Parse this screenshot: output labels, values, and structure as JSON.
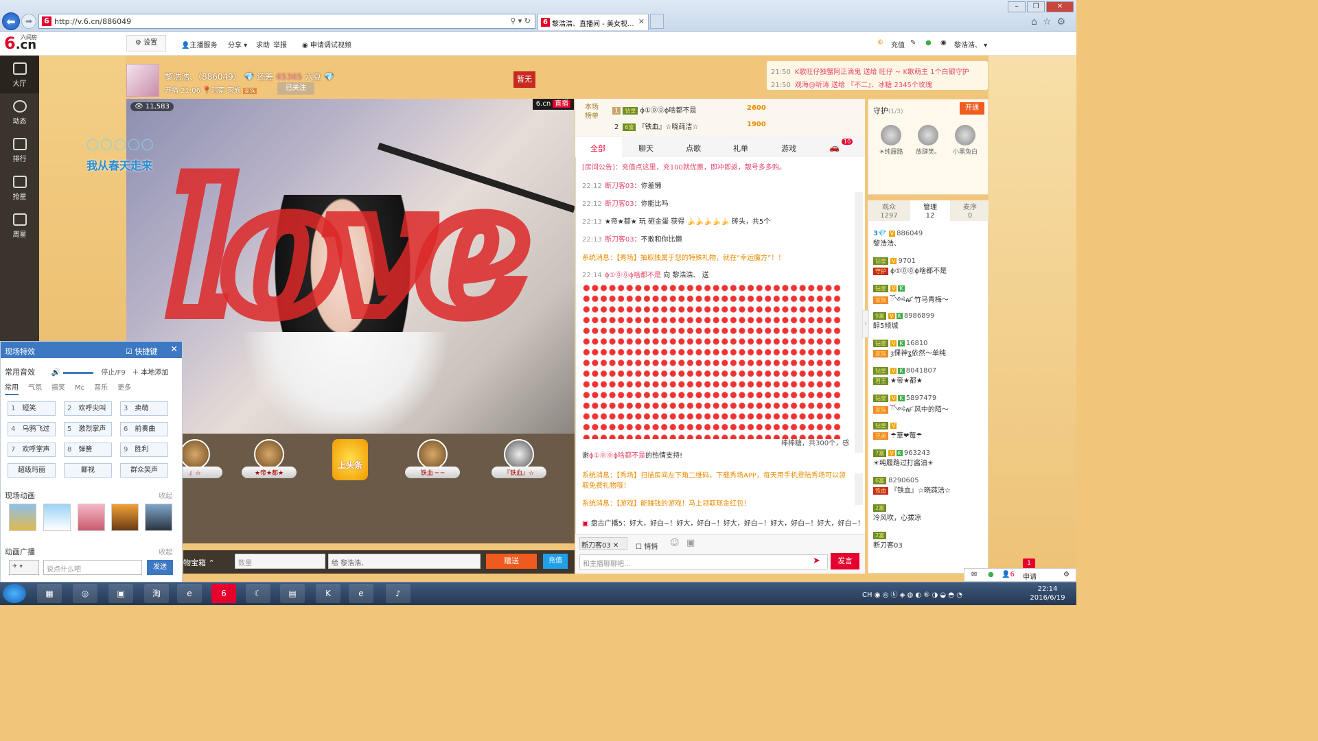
{
  "browser": {
    "url": "http://v.6.cn/886049",
    "tab_title": "黎浩浩、直播间 - 美女视...",
    "back": "⬅",
    "fwd": "➡",
    "addr_tools": "⚲ ▾ ↻"
  },
  "header": {
    "logo": "6.cn",
    "logo_small": "六间房",
    "settings": "⚙ 设置",
    "anchor_service": "主播服务",
    "share": "分享",
    "help": "求助",
    "report": "举报",
    "debug": "申请调试视频",
    "charge": "充值",
    "user": "黎浩浩、"
  },
  "sidebar": {
    "items": [
      {
        "label": "大厅",
        "icon": "tv-icon"
      },
      {
        "label": "动态",
        "icon": "compass-icon"
      },
      {
        "label": "排行",
        "icon": "crown-icon"
      },
      {
        "label": "抢星",
        "icon": "star-icon"
      },
      {
        "label": "周星",
        "icon": "gift-icon"
      }
    ]
  },
  "room": {
    "title": "黎浩浩、（886049）",
    "gap_prefix": "还差",
    "gap_value": "65365",
    "gap_unit": "六豆",
    "start": "开播 21:06",
    "location": "河南",
    "family": "家族",
    "follow": "已关注",
    "pause": "暂无",
    "viewers": "11,583",
    "live_logo": "6.cn",
    "live": "直播"
  },
  "notices": [
    {
      "time": "21:50",
      "text": "K歌旺仔独蟹阿正滴鬼 送给 旺仔 ~ K歌萌主 1个白银守护"
    },
    {
      "time": "21:50",
      "text": "观海@听涛 送给 『不二』、冰糖 2345个玫瑰"
    }
  ],
  "overlay": {
    "love": "love",
    "spring": "我从春天走来",
    "bubbles": "◯◯◯◯◯"
  },
  "rank_strip": [
    {
      "name": "』☆"
    },
    {
      "name": "★帝★都★"
    },
    {
      "name": "上头条"
    },
    {
      "name": "铁血 ─ ─"
    },
    {
      "name": "『铁血』☆"
    }
  ],
  "fx": {
    "title": "现场特效",
    "shortcut": "快捷键",
    "close": "✕",
    "sound_label": "常用音效",
    "stop": "停止/F9",
    "add_local": "＋ 本地添加",
    "tabs": [
      "常用",
      "气氛",
      "搞笑",
      "Mc",
      "音乐",
      "更多"
    ],
    "buttons": [
      {
        "n": "1",
        "l": "短笑"
      },
      {
        "n": "2",
        "l": "欢呼尖叫"
      },
      {
        "n": "3",
        "l": "卖萌"
      },
      {
        "n": "4",
        "l": "乌鸦飞过"
      },
      {
        "n": "5",
        "l": "激烈掌声"
      },
      {
        "n": "6",
        "l": "前奏曲"
      },
      {
        "n": "7",
        "l": "欢呼掌声"
      },
      {
        "n": "8",
        "l": "弹簧"
      },
      {
        "n": "9",
        "l": "胜利"
      }
    ],
    "wide_buttons": [
      "超级玛丽",
      "鄙视",
      "群众笑声"
    ],
    "anim_label": "现场动画",
    "collapse": "收起",
    "bc_label": "动画广播",
    "collapse2": "收起",
    "input_placeholder": "说点什么吧",
    "send": "发送"
  },
  "giftbar": {
    "treasure": "物宝箱 ⌃",
    "qty_placeholder": "数量",
    "to_prefix": "给",
    "to_name": "黎浩浩、",
    "give": "赠送",
    "charge": "充值"
  },
  "chat": {
    "rank_label": "本场榜单",
    "ranks": [
      {
        "pos": "1",
        "name": "ϕ①⓪⓪ϕ啥都不是",
        "amt": "2600"
      },
      {
        "pos": "2",
        "name": "『铁血』☆晓莼洁☆",
        "amt": "1900"
      }
    ],
    "tabs": [
      "全部",
      "聊天",
      "点歌",
      "礼单",
      "游戏"
    ],
    "tab_badge": "10",
    "announce_label": "[房间公告]",
    "announce": "：充值点这里，充100就优惠，即冲即返，靓号多多购。",
    "lines": [
      {
        "tm": "22:12",
        "nm": "断刀客03",
        "msg": "：你差懒"
      },
      {
        "tm": "22:12",
        "nm": "断刀客03",
        "msg": "：你能比吗"
      },
      {
        "tm": "22:13",
        "nm": "★帝★都★",
        "msg": "玩 砸金蛋 获得 🍌🍌🍌🍌🍌 砖头，共5个"
      },
      {
        "tm": "22:13",
        "nm": "断刀客03",
        "msg": "：不敢和你比懒"
      }
    ],
    "sys1": "系统消息：【秀场】抽取独属于您的特殊礼物，就在“幸运魔方”！！",
    "gift_line_tm": "22:14",
    "gift_line_nm": "ϕ①⓪⓪ϕ啥都不是",
    "gift_line_to": "向 黎浩浩、 送",
    "candy_tail": "棒棒糖，共300个，感",
    "thanks_pre": "谢",
    "thanks_nm": "ϕ①⓪⓪ϕ啥都不是",
    "thanks_post": "的热情支持!",
    "sys2": "系统消息：【秀场】扫描房间左下角二维码，下载秀场APP，每天用手机登陆秀场可以领",
    "sys2b": "取免费礼物哦！",
    "sys3": "系统消息：【游戏】能赚钱的游戏！马上领取现金红包！",
    "broadcast": "盘古广播5：好大，好白~！好大，好白~！好大，好白~！好大，好白~！好大，好白~！好",
    "to_user": "断刀客03",
    "whisper": "悄悄",
    "input_placeholder": "和主播聊聊吧...",
    "send": "发言"
  },
  "guard": {
    "title": "守护",
    "count": "(1/3)",
    "open": "开通",
    "members": [
      "☀纯履路",
      "放肆笑。",
      "小黑兔白"
    ]
  },
  "users": {
    "tabs": [
      {
        "l": "观众",
        "n": "1297"
      },
      {
        "l": "管理",
        "n": "12"
      },
      {
        "l": "麦序",
        "n": "0"
      }
    ],
    "list": [
      {
        "num": "886049",
        "name": "黎浩浩、"
      },
      {
        "num": "9701",
        "name": "ϕ①⓪⓪ϕ啥都不是"
      },
      {
        "num": "",
        "name": "ོ༺ꫛ 竹马青梅～"
      },
      {
        "num": "8986899",
        "name": "醉5倾城"
      },
      {
        "num": "16810",
        "name": "ȝ倮神ʓ依然～单纯"
      },
      {
        "num": "8041807",
        "name": "★帝★都★"
      },
      {
        "num": "5897479",
        "name": "ོ༺ꫛ 风中的陌～"
      },
      {
        "num": "",
        "name": "☂華❤莓☂"
      },
      {
        "num": "963243",
        "name": "☀纯履路过打酱油☀"
      },
      {
        "num": "8290605",
        "name": "『铁血』☆晓莼洁☆"
      },
      {
        "num": "",
        "name": "冷风吹，心拔凉"
      },
      {
        "num": "",
        "name": "断刀客03"
      }
    ]
  },
  "status": {
    "apply": "申请",
    "badge": "1",
    "count": "6"
  },
  "taskbar": {
    "time": "22:14",
    "date": "2016/6/19",
    "lang": "CH"
  }
}
